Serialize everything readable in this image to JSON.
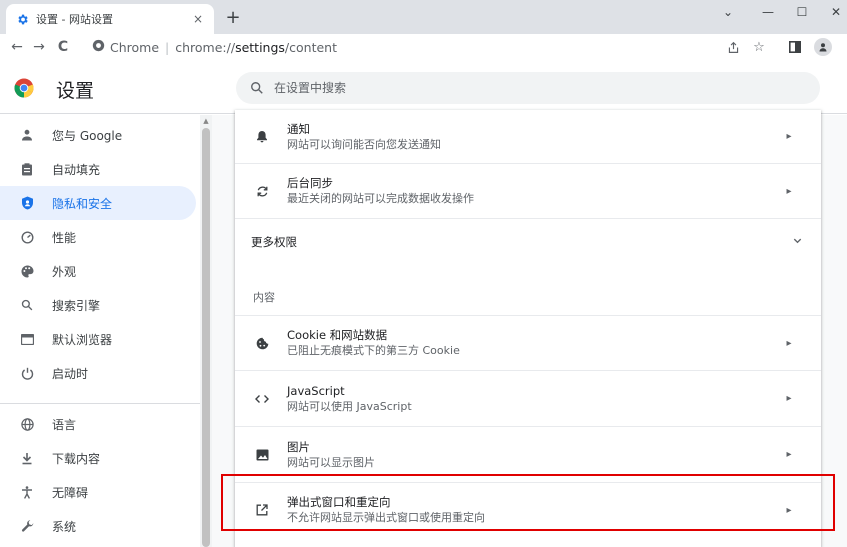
{
  "tab": {
    "title": "设置 - 网站设置",
    "close": "×"
  },
  "new_tab": "+",
  "window": {
    "minimize": "—",
    "maximize": "☐",
    "close": "✕",
    "dropdown": "⌄"
  },
  "toolbar": {
    "back": "←",
    "forward": "→",
    "reload": "C",
    "url_host": "Chrome",
    "url_sep": "|",
    "url_scheme": "chrome://",
    "url_path": "settings",
    "url_rest": "/content"
  },
  "header": {
    "title": "设置",
    "search_placeholder": "在设置中搜索"
  },
  "sidebar": {
    "items": [
      {
        "label": "您与 Google",
        "icon": "person-icon"
      },
      {
        "label": "自动填充",
        "icon": "clipboard-icon"
      },
      {
        "label": "隐私和安全",
        "icon": "shield-icon",
        "active": true
      },
      {
        "label": "性能",
        "icon": "speedometer-icon"
      },
      {
        "label": "外观",
        "icon": "palette-icon"
      },
      {
        "label": "搜索引擎",
        "icon": "search-icon"
      },
      {
        "label": "默认浏览器",
        "icon": "browser-icon"
      },
      {
        "label": "启动时",
        "icon": "power-icon"
      },
      {
        "label": "语言",
        "icon": "globe-icon"
      },
      {
        "label": "下载内容",
        "icon": "download-icon"
      },
      {
        "label": "无障碍",
        "icon": "accessibility-icon"
      },
      {
        "label": "系统",
        "icon": "wrench-icon"
      }
    ]
  },
  "content": {
    "notifications": {
      "title": "通知",
      "subtitle": "网站可以询问能否向您发送通知"
    },
    "background_sync": {
      "title": "后台同步",
      "subtitle": "最近关闭的网站可以完成数据收发操作"
    },
    "more_permissions": "更多权限",
    "content_label": "内容",
    "cookies": {
      "title": "Cookie 和网站数据",
      "subtitle": "已阻止无痕模式下的第三方 Cookie"
    },
    "javascript": {
      "title": "JavaScript",
      "subtitle": "网站可以使用 JavaScript"
    },
    "images": {
      "title": "图片",
      "subtitle": "网站可以显示图片"
    },
    "popups": {
      "title": "弹出式窗口和重定向",
      "subtitle": "不允许网站显示弹出式窗口或使用重定向"
    }
  },
  "colors": {
    "accent": "#1a73e8",
    "active_bg": "#e8f0fe",
    "highlight": "#e00000"
  }
}
